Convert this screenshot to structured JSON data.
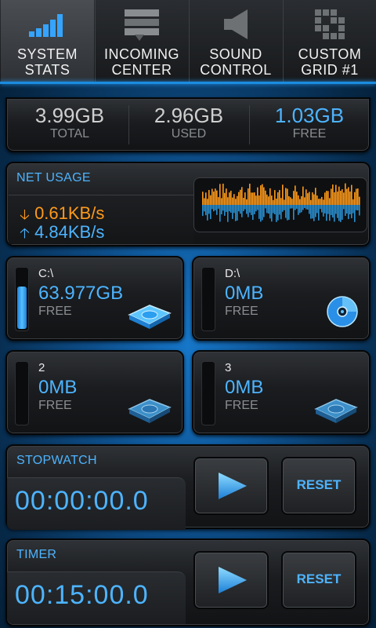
{
  "tabs": [
    {
      "line1": "SYSTEM",
      "line2": "STATS",
      "active": true,
      "icon": "signal-bars-icon"
    },
    {
      "line1": "INCOMING",
      "line2": "CENTER",
      "active": false,
      "icon": "inbox-list-icon"
    },
    {
      "line1": "SOUND",
      "line2": "CONTROL",
      "active": false,
      "icon": "speaker-icon"
    },
    {
      "line1": "CUSTOM",
      "line2": "GRID #1",
      "active": false,
      "icon": "grid-icon"
    }
  ],
  "memory": {
    "total": {
      "value": "3.99GB",
      "label": "TOTAL"
    },
    "used": {
      "value": "2.96GB",
      "label": "USED"
    },
    "free": {
      "value": "1.03GB",
      "label": "FREE"
    }
  },
  "net": {
    "title": "NET USAGE",
    "down": "0.61KB/s",
    "up": "4.84KB/s",
    "down_color": "#ff9a1a",
    "up_color": "#4db4ff"
  },
  "drives": [
    {
      "name": "C:\\",
      "value": "63.977GB",
      "label": "FREE",
      "fill": 0.68,
      "icon": "hard-drive-icon"
    },
    {
      "name": "D:\\",
      "value": "0MB",
      "label": "FREE",
      "fill": 0,
      "icon": "cd-disc-icon"
    },
    {
      "name": "2",
      "value": "0MB",
      "label": "FREE",
      "fill": 0,
      "icon": "hard-drive-icon"
    },
    {
      "name": "3",
      "value": "0MB",
      "label": "FREE",
      "fill": 0,
      "icon": "hard-drive-icon"
    }
  ],
  "stopwatch": {
    "title": "STOPWATCH",
    "time": "00:00:00.0",
    "reset": "RESET"
  },
  "timer": {
    "title": "TIMER",
    "time": "00:15:00.0",
    "reset": "RESET"
  },
  "colors": {
    "accent": "#4db4ff",
    "orange": "#ff9a1a"
  }
}
